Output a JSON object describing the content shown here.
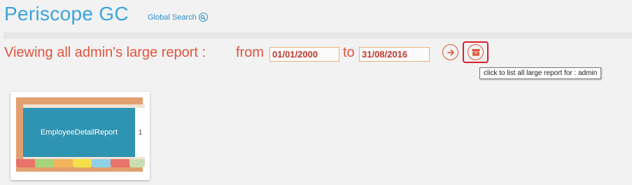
{
  "header": {
    "app_title": "Periscope GC",
    "global_search_label": "Global Search",
    "global_search_icon": "magnifier-icon"
  },
  "report_bar": {
    "viewing_label": "Viewing all admin's large report :",
    "from_label": "from",
    "from_date": "01/01/2000",
    "to_label": "to",
    "to_date": "31/08/2016",
    "go_icon": "arrow-right-circle-icon",
    "list_icon": "archive-box-icon",
    "tooltip": "click to list all large report for : admin"
  },
  "reports": [
    {
      "name": "EmployeeDetailReport",
      "count": "1"
    }
  ],
  "colors": {
    "title_blue": "#3aa3dc",
    "accent_red": "#e0553d",
    "highlight_red": "#d9202a",
    "card_teal": "#2f93b2",
    "binder_orange": "#e2a071",
    "tabs": [
      "#e9736a",
      "#a6d37a",
      "#f0b35a",
      "#f3e04a",
      "#8fd0e6",
      "#e9736a",
      "#c9dfb0"
    ]
  }
}
